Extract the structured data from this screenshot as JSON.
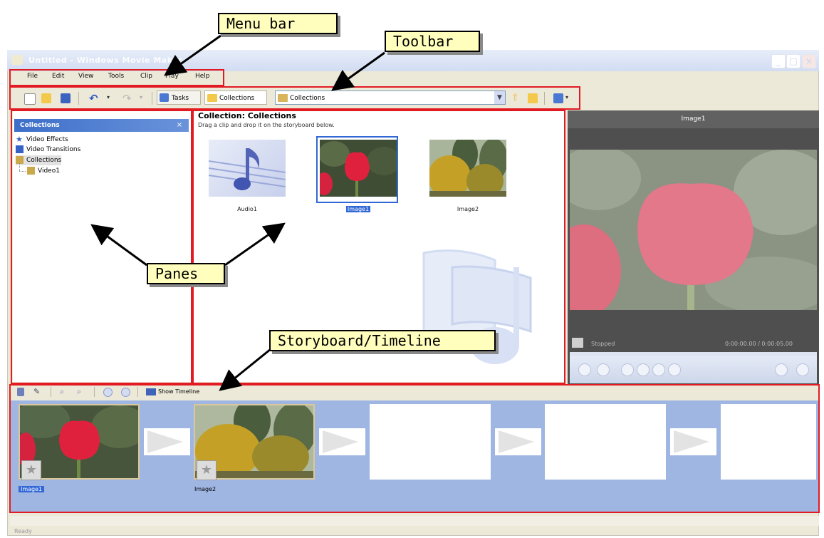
{
  "window": {
    "title": "Untitled - Windows Movie Maker",
    "min_icon": "minimize-icon",
    "max_icon": "maximize-icon",
    "close_icon": "close-icon"
  },
  "menu": [
    "File",
    "Edit",
    "View",
    "Tools",
    "Clip",
    "Play",
    "Help"
  ],
  "toolbar": {
    "tasks_label": "Tasks",
    "collections_label": "Collections",
    "combo_value": "Collections"
  },
  "collections_pane": {
    "header": "Collections",
    "close": "×",
    "items": [
      "Video Effects",
      "Video Transitions",
      "Collections",
      "Video1"
    ]
  },
  "content_pane": {
    "title": "Collection: Collections",
    "subtitle": "Drag a clip and drop it on the storyboard below.",
    "clips": [
      "Audio1",
      "Image1",
      "Image2"
    ]
  },
  "monitor": {
    "title": "Image1",
    "status": "Stopped",
    "time": "0:00:00.00 / 0:00:05.00"
  },
  "storyboard": {
    "toolbar_label": "Show Timeline",
    "clips": [
      "Image1",
      "Image2"
    ]
  },
  "status_bar": "Ready",
  "annotations": {
    "menu_bar": "Menu bar",
    "toolbar": "Toolbar",
    "panes": "Panes",
    "storyboard": "Storyboard/Timeline"
  },
  "colors": {
    "annotation_outline": "#e21b23",
    "callout_fill": "#fffebd",
    "storyboard_fill": "#9fb5e2",
    "pane_header": "#3d6fc9"
  }
}
